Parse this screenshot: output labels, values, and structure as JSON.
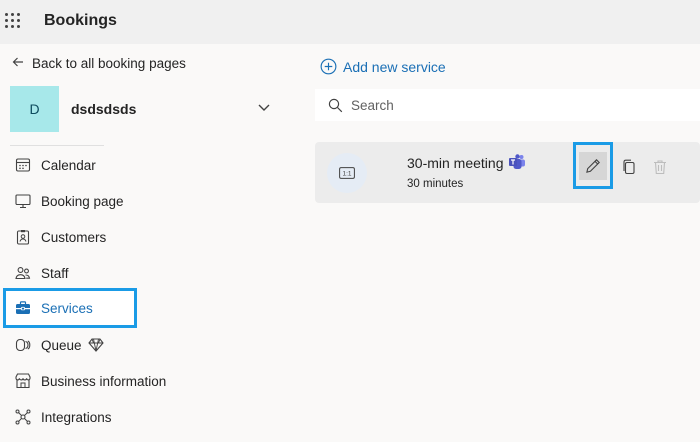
{
  "app": {
    "title": "Bookings"
  },
  "sidebar": {
    "back_label": "Back to all booking pages",
    "page": {
      "initial": "D",
      "name": "dsdsdsds"
    },
    "items": [
      {
        "label": "Calendar",
        "icon": "calendar-icon"
      },
      {
        "label": "Booking page",
        "icon": "monitor-icon"
      },
      {
        "label": "Customers",
        "icon": "contact-card-icon"
      },
      {
        "label": "Staff",
        "icon": "people-icon"
      },
      {
        "label": "Services",
        "icon": "briefcase-icon",
        "selected": true
      },
      {
        "label": "Queue",
        "icon": "queue-icon",
        "badge_icon": "diamond-icon"
      },
      {
        "label": "Business information",
        "icon": "storefront-icon"
      },
      {
        "label": "Integrations",
        "icon": "integrations-icon"
      }
    ]
  },
  "main": {
    "add_service_label": "Add new service",
    "search": {
      "placeholder": "Search",
      "value": ""
    },
    "services": [
      {
        "title": "30-min meeting",
        "duration": "30 minutes",
        "icon_text": "1:1"
      }
    ]
  },
  "colors": {
    "accent": "#1a6fb5",
    "highlight_border": "#1a9be6",
    "avatar_bg": "#a7e8ea"
  }
}
